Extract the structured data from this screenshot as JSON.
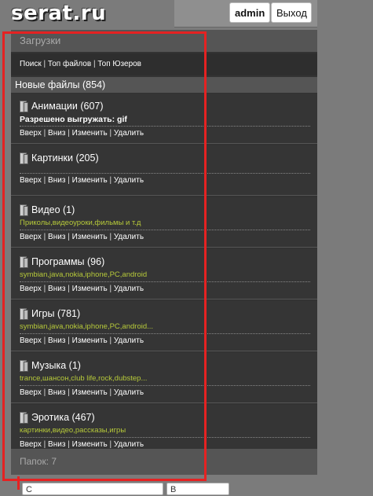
{
  "header": {
    "logo": "serat.ru",
    "user_button": "admin",
    "logout_button": "Выход"
  },
  "downloads": {
    "title": "Загрузки",
    "links": [
      "Поиск",
      "Топ файлов",
      "Топ Юзеров"
    ]
  },
  "new_files": {
    "label": "Новые файлы (854)"
  },
  "categories": [
    {
      "title": "Анимации (607)",
      "desc_label": "Разрешено выгружать:",
      "desc_value": "gif",
      "actions": [
        "Вверх",
        "Вниз",
        "Изменить",
        "Удалить"
      ]
    },
    {
      "title": "Картинки (205)",
      "desc": "",
      "actions": [
        "Вверх",
        "Вниз",
        "Изменить",
        "Удалить"
      ]
    },
    {
      "title": "Видео (1)",
      "desc": "Приколы,видеоуроки,фильмы и т.д",
      "actions": [
        "Вверх",
        "Вниз",
        "Изменить",
        "Удалить"
      ]
    },
    {
      "title": "Программы (96)",
      "desc": "symbian,java,nokia,iphone,PC,android",
      "actions": [
        "Вверх",
        "Вниз",
        "Изменить",
        "Удалить"
      ]
    },
    {
      "title": "Игры (781)",
      "desc": "symbian,java,nokia,iphone,PC,android...",
      "actions": [
        "Вверх",
        "Вниз",
        "Изменить",
        "Удалить"
      ]
    },
    {
      "title": "Музыка (1)",
      "desc": "trance,шансон,club life,rock,dubstep...",
      "actions": [
        "Вверх",
        "Вниз",
        "Изменить",
        "Удалить"
      ]
    },
    {
      "title": "Эротика (467)",
      "desc": "картинки,видео,рассказы,игры",
      "actions": [
        "Вверх",
        "Вниз",
        "Изменить",
        "Удалить"
      ]
    }
  ],
  "folders": {
    "label": "Папок: 7"
  },
  "bottom": {
    "input_text": "С",
    "button_text": "В"
  },
  "colors": {
    "highlight_frame": "#e52222",
    "description_text": "#b6c93a"
  }
}
